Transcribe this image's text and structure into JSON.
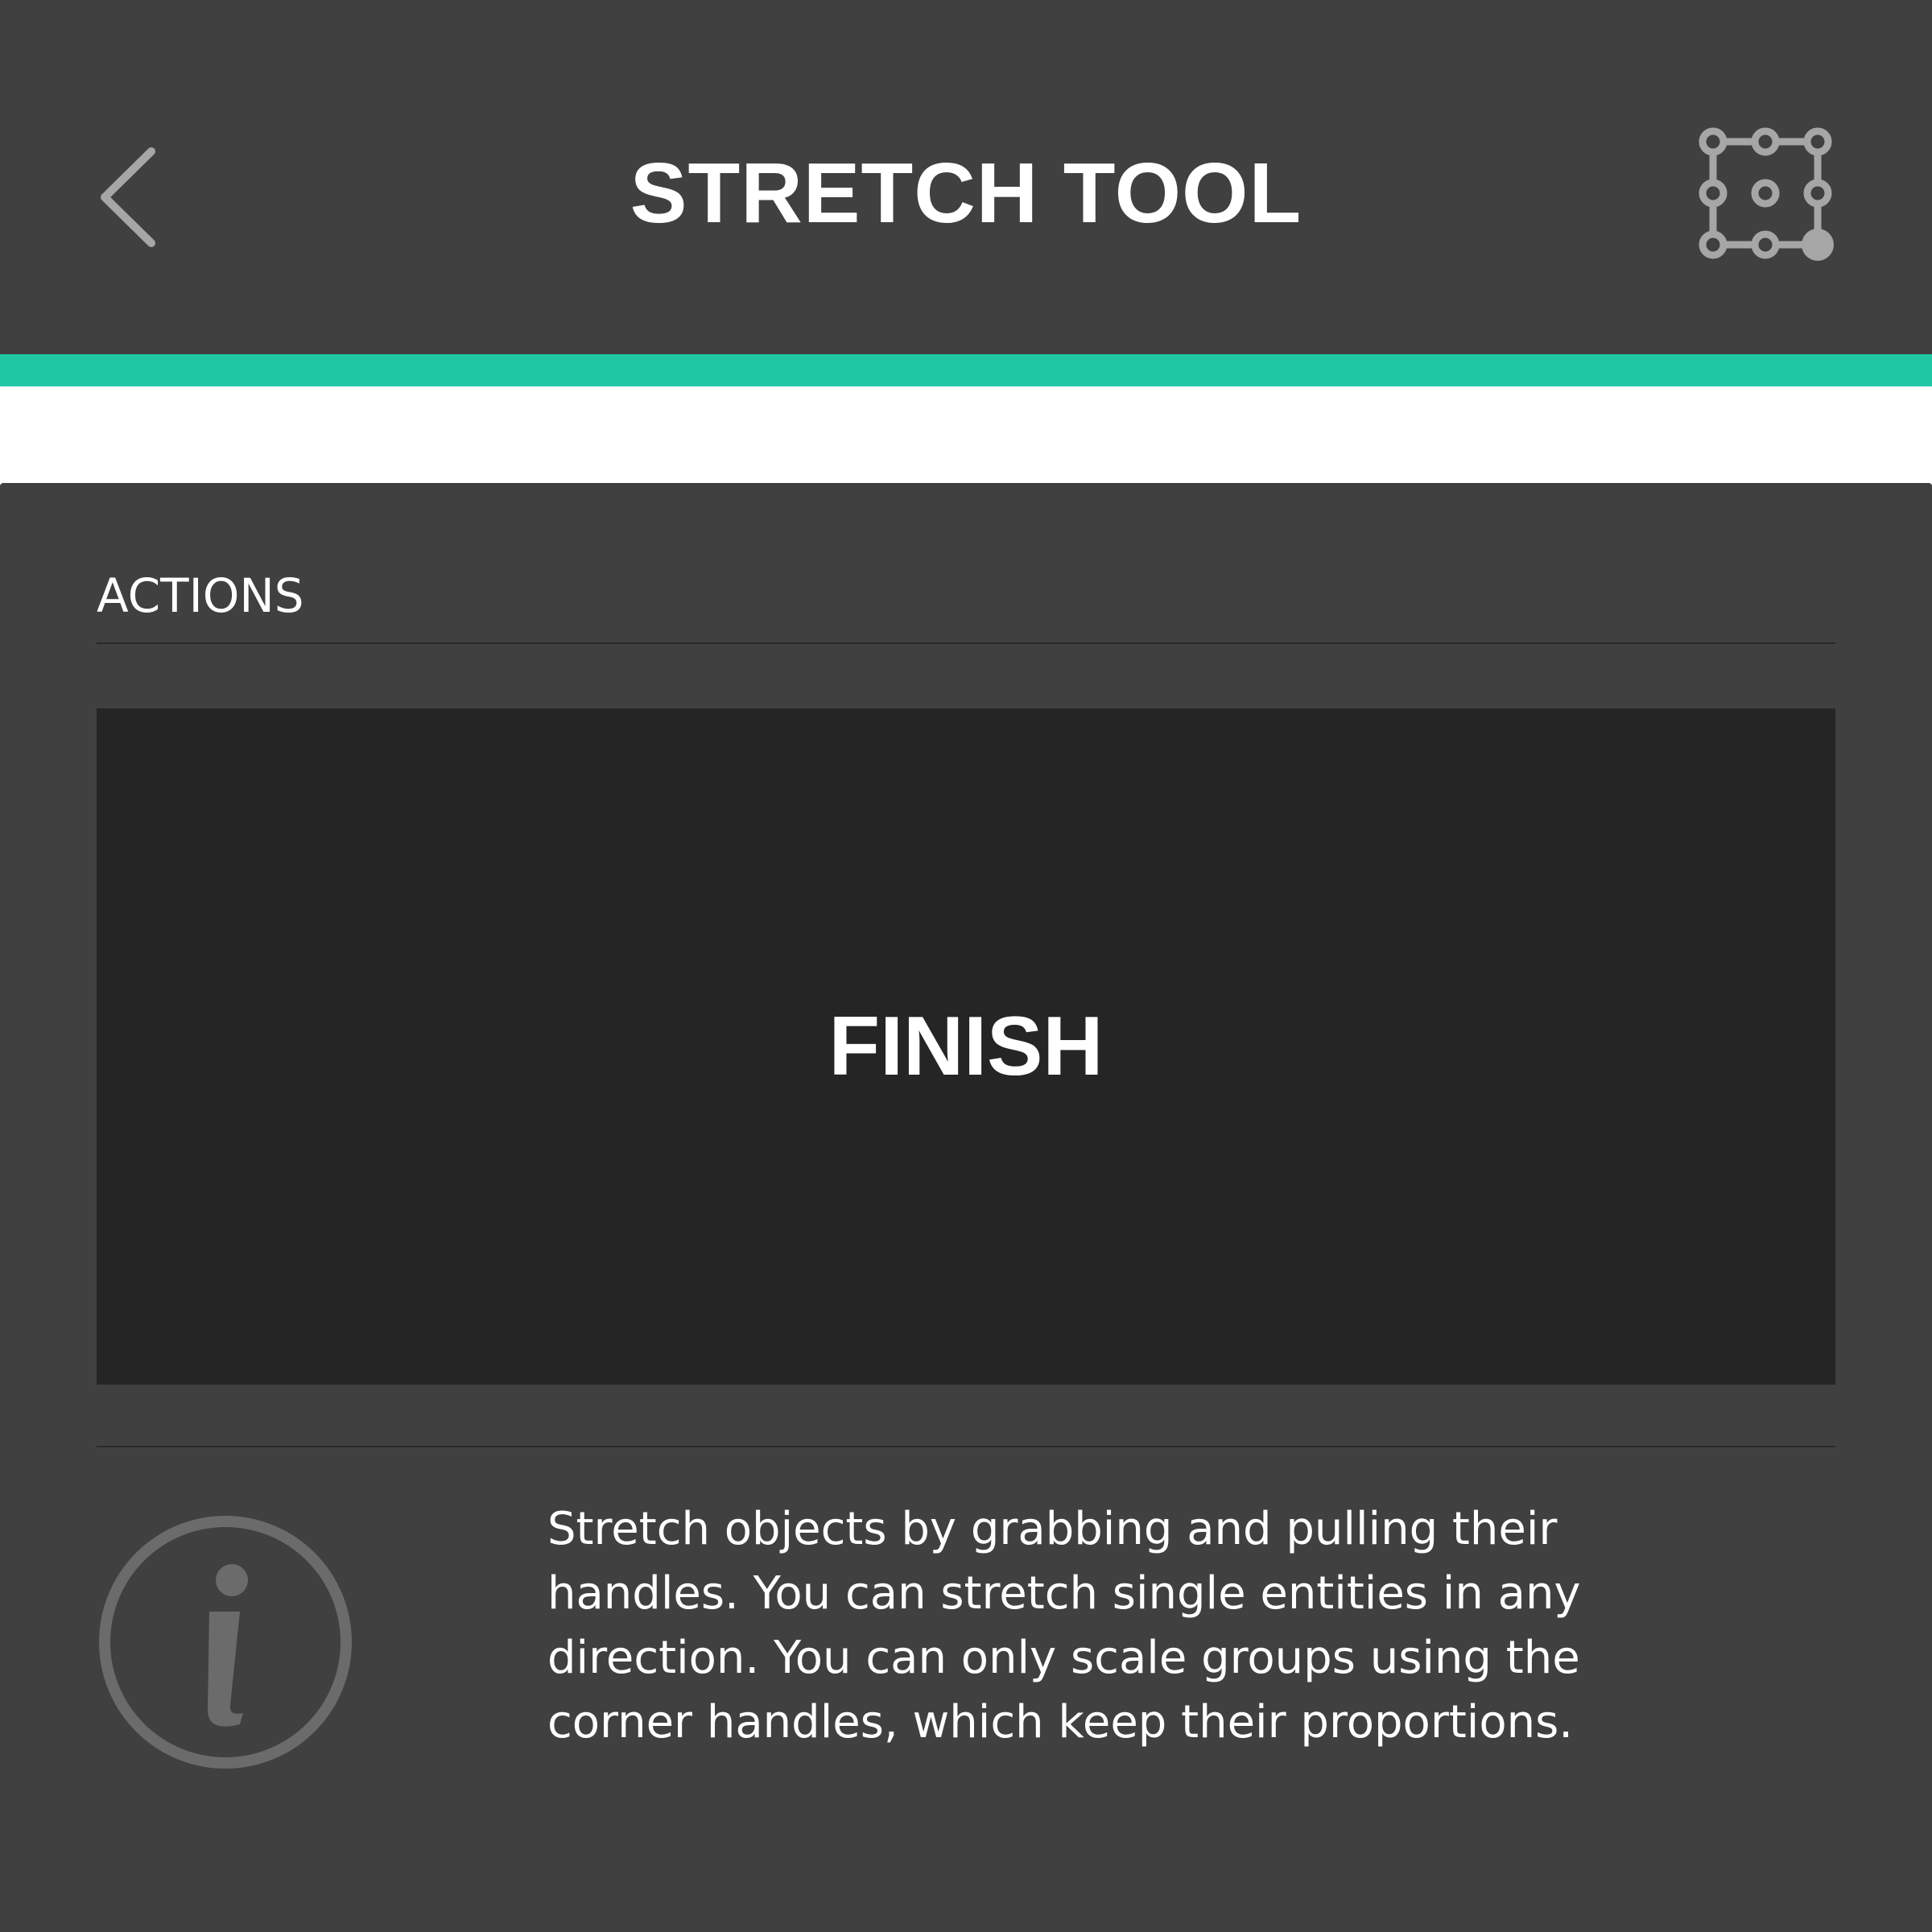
{
  "header": {
    "title": "STRETCH TOOL",
    "back_icon": "chevron-left-icon",
    "tool_icon": "stretch-handles-icon"
  },
  "colors": {
    "header_bg": "#404040",
    "accent": "#1fc7a5",
    "panel_bg": "#404040",
    "button_bg": "#252525",
    "icon_gray": "#a6a6a6",
    "info_icon_gray": "#6b6b6b"
  },
  "actions": {
    "section_label": "ACTIONS",
    "finish_label": "FINISH"
  },
  "info": {
    "icon": "info-icon",
    "text": "Stretch objects by grabbing and pulling their handles. You can stretch single entities in any direction. You can only scale groups using the corner handles, which keep their proportions."
  }
}
